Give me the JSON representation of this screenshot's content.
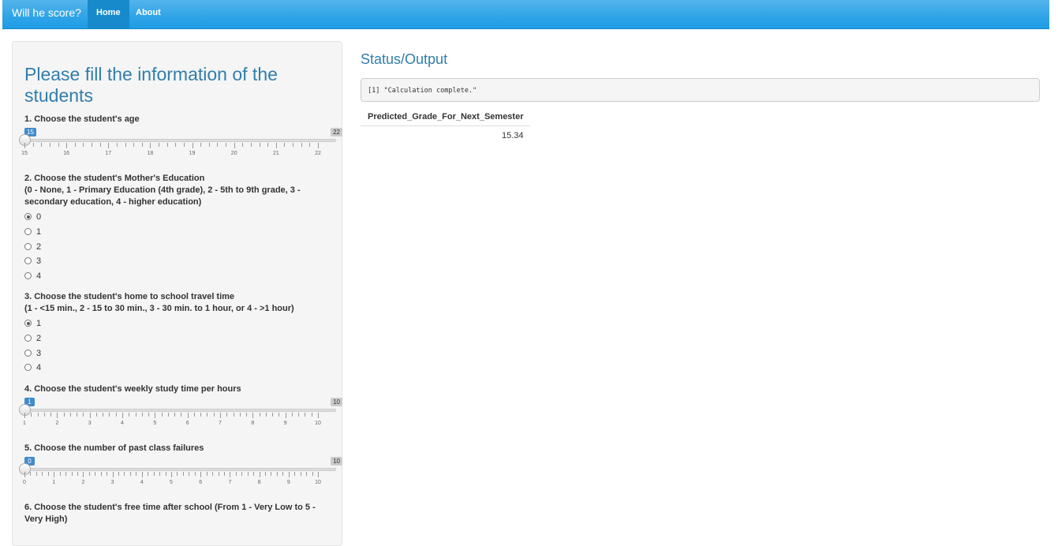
{
  "nav": {
    "brand": "Will he score?",
    "tabs": [
      {
        "label": "Home",
        "active": true
      },
      {
        "label": "About",
        "active": false
      }
    ]
  },
  "sidebar": {
    "title": "Please fill the information of the students",
    "q1": {
      "label": "1. Choose the student's age",
      "value": 15,
      "min": 15,
      "max": 22,
      "min_label": "15",
      "max_label": "22",
      "ticks": [
        "15",
        "16",
        "17",
        "18",
        "19",
        "20",
        "21",
        "22"
      ]
    },
    "q2": {
      "label": "2. Choose the student's Mother's Education",
      "sub": "(0 - None, 1 - Primary Education (4th grade), 2 - 5th to 9th grade, 3 - secondary education, 4 - higher education)",
      "options": [
        "0",
        "1",
        "2",
        "3",
        "4"
      ],
      "selected": "0"
    },
    "q3": {
      "label": "3. Choose the student's home to school travel time",
      "sub": "(1 - <15 min., 2 - 15 to 30 min., 3 - 30 min. to 1 hour, or 4 - >1 hour)",
      "options": [
        "1",
        "2",
        "3",
        "4"
      ],
      "selected": "1"
    },
    "q4": {
      "label": "4. Choose the student's weekly study time per hours",
      "value": 1,
      "min": 1,
      "max": 10,
      "min_label": "1",
      "max_label": "10",
      "ticks": [
        "1",
        "2",
        "3",
        "4",
        "5",
        "6",
        "7",
        "8",
        "9",
        "10"
      ]
    },
    "q5": {
      "label": "5. Choose the number of past class failures",
      "value": 0,
      "min": 0,
      "max": 10,
      "min_label": "0",
      "max_label": "10",
      "ticks": [
        "0",
        "1",
        "2",
        "3",
        "4",
        "5",
        "6",
        "7",
        "8",
        "9",
        "10"
      ]
    },
    "q6": {
      "label": "6. Choose the student's free time after school (From 1 - Very Low to 5 - Very High)"
    }
  },
  "main": {
    "title": "Status/Output",
    "status": "[1] \"Calculation complete.\"",
    "table": {
      "header": "Predicted_Grade_For_Next_Semester",
      "value": "15.34"
    }
  }
}
